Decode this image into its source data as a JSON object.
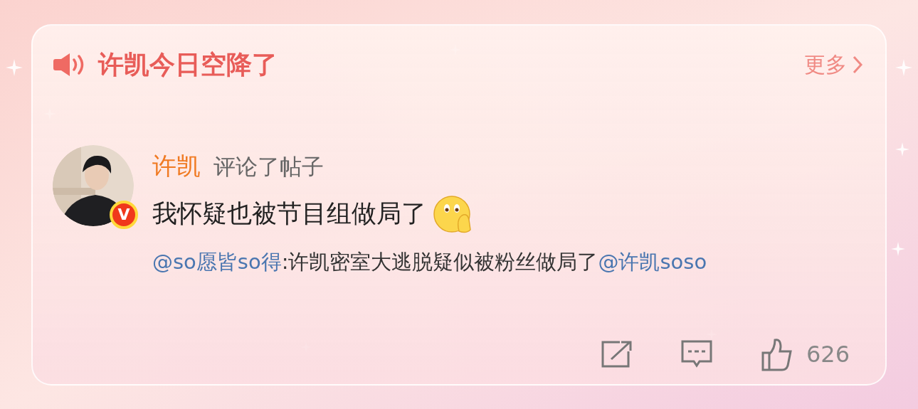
{
  "header": {
    "title": "许凯今日空降了",
    "more": "更多"
  },
  "post": {
    "author": "许凯",
    "action": "评论了帖子",
    "badge": "V",
    "text": "我怀疑也被节目组做局了",
    "quote": [
      {
        "kind": "mention",
        "text": "@so愿皆so得"
      },
      {
        "kind": "text",
        "text": ":许凯密室大逃脱疑似被粉丝做局了"
      },
      {
        "kind": "mention",
        "text": "@许凯soso"
      }
    ]
  },
  "actions": {
    "likes": "626"
  }
}
